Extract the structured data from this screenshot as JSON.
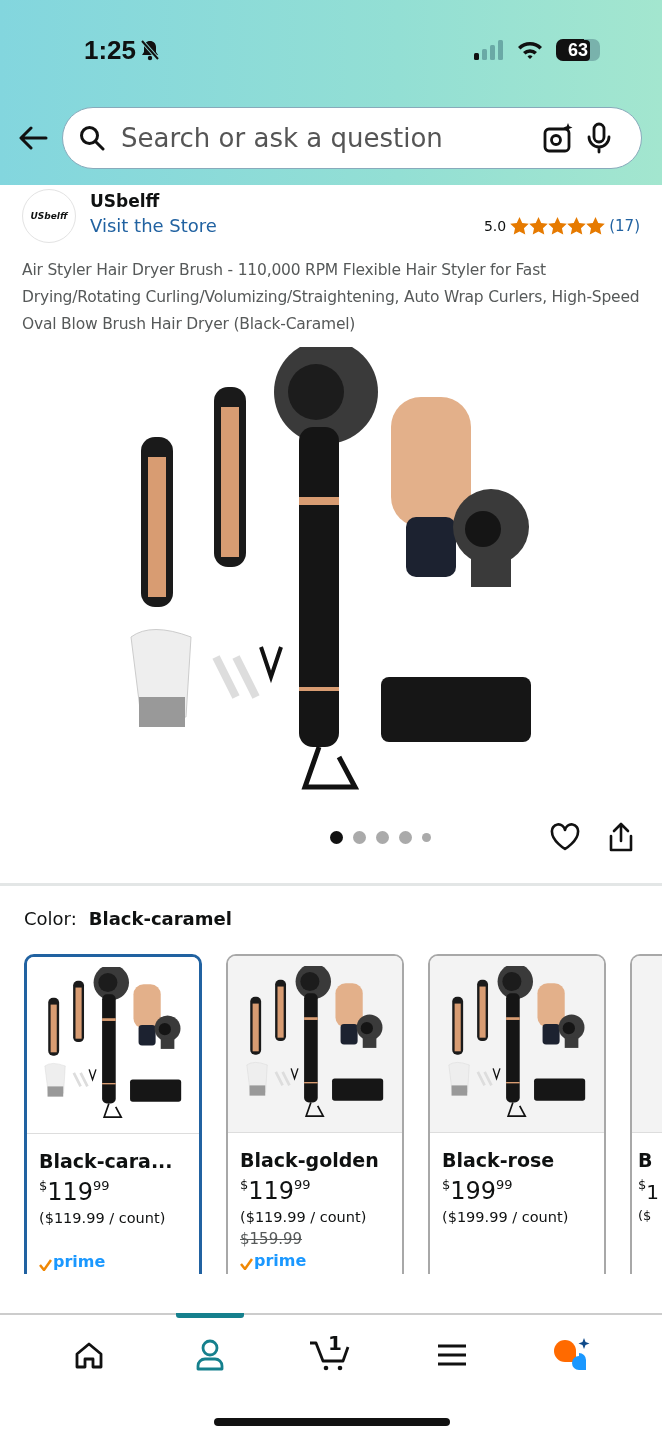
{
  "status_bar": {
    "time": "1:25",
    "battery": "63"
  },
  "search": {
    "placeholder": "Search or ask a question"
  },
  "seller": {
    "name": "USbelff",
    "logo_text": "USbelff",
    "store_link": "Visit the Store",
    "rating": "5.0",
    "stars": 5,
    "review_count": "(17)"
  },
  "product_title": "Air Styler Hair Dryer Brush - 110,000 RPM Flexible Hair Styler for Fast Drying/Rotating Curling/Volumizing/Straightening, Auto Wrap Curlers, High-Speed Oval Blow Brush Hair Dryer (Black-Caramel)",
  "gallery": {
    "dots": [
      {
        "selected": true
      },
      {
        "selected": false
      },
      {
        "selected": false
      },
      {
        "selected": false
      },
      {
        "selected": false
      }
    ]
  },
  "color_picker": {
    "label": "Color:",
    "value": "Black-caramel"
  },
  "variants": [
    {
      "kind": "full",
      "name": "Black-cara...",
      "currency": "$",
      "price_whole": "119",
      "price_fraction": "99",
      "unit_price": "($119.99 / count)",
      "selected": true,
      "prime_label": "prime"
    },
    {
      "kind": "full",
      "name": "Black-golden",
      "currency": "$",
      "price_whole": "119",
      "price_fraction": "99",
      "unit_price": "($119.99 / count)",
      "list_price": "$159.99",
      "selected": false,
      "prime_label": "prime"
    },
    {
      "kind": "full",
      "name": "Black-rose",
      "currency": "$",
      "price_whole": "199",
      "price_fraction": "99",
      "unit_price": "($199.99 / count)",
      "selected": false
    },
    {
      "kind": "partial",
      "name": "B",
      "currency": "$",
      "price_whole": "1",
      "unit_price": "($",
      "selected": false
    }
  ],
  "bottom_nav": [
    {
      "kind": "home",
      "selected": false
    },
    {
      "kind": "profile",
      "selected": true
    },
    {
      "kind": "cart",
      "badge": "1",
      "selected": false
    },
    {
      "kind": "menu",
      "selected": false
    },
    {
      "kind": "assistant",
      "selected": false
    }
  ]
}
